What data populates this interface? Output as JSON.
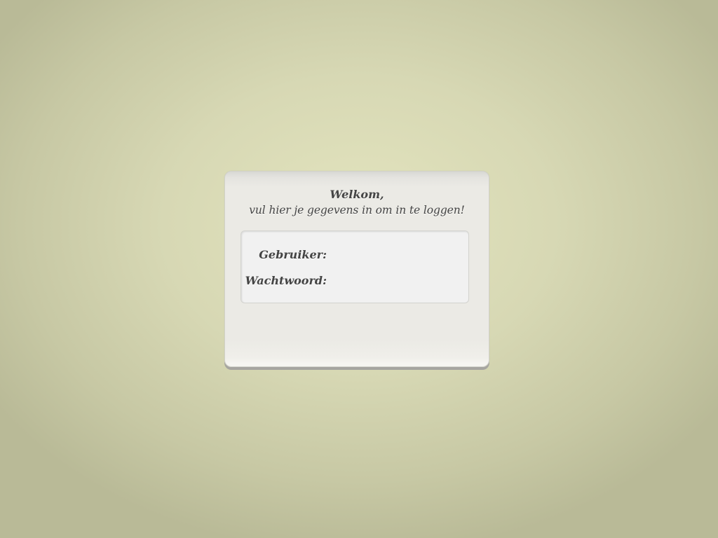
{
  "login": {
    "welcome_title": "Welkom,",
    "welcome_subtitle": "vul hier je gegevens in om in te loggen!",
    "fields": [
      {
        "label": "Gebruiker:",
        "value": ""
      },
      {
        "label": "Wachtwoord:",
        "value": ""
      }
    ]
  },
  "colors": {
    "background": "#d7d8b4",
    "panel": "#ebeae5",
    "form_box": "#f1f1f1",
    "text": "#444444"
  }
}
